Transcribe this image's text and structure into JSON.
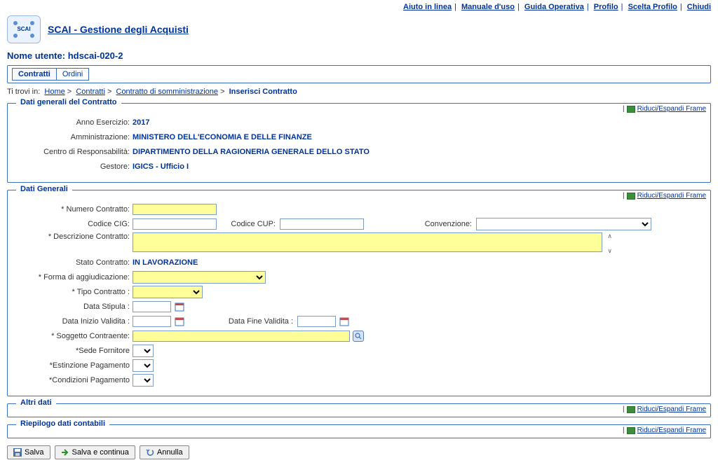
{
  "topLinks": {
    "help": "Aiuto in linea",
    "manual": "Manuale d'uso",
    "guide": "Guida Operativa",
    "profile": "Profilo",
    "choose": "Scelta Profilo",
    "close": "Chiudi"
  },
  "appTitle": "SCAI - Gestione degli Acquisti",
  "userLabel": "Nome utente:",
  "userName": "hdscai-020-2",
  "tabs": {
    "contratti": "Contratti",
    "ordini": "Ordini"
  },
  "breadcrumb": {
    "prefix": "Ti trovi in:",
    "home": "Home",
    "contratti": "Contratti",
    "somm": "Contratto di somministrazione",
    "current": "Inserisci Contratto"
  },
  "frameToggle": "Riduci/Espandi Frame",
  "section1": {
    "legend": "Dati generali del Contratto",
    "anno": {
      "label": "Anno Esercizio:",
      "value": "2017"
    },
    "ammin": {
      "label": "Amministrazione:",
      "value": "MINISTERO DELL'ECONOMIA E DELLE FINANZE"
    },
    "centro": {
      "label": "Centro di Responsabilità:",
      "value": "DIPARTIMENTO DELLA RAGIONERIA GENERALE DELLO STATO"
    },
    "gestore": {
      "label": "Gestore:",
      "value": "IGICS - Ufficio I"
    }
  },
  "section2": {
    "legend": "Dati Generali",
    "numero": "* Numero Contratto:",
    "cig": "Codice CIG:",
    "cup": "Codice CUP:",
    "conv": "Convenzione:",
    "desc": "* Descrizione Contratto:",
    "stato": {
      "label": "Stato Contratto:",
      "value": "IN LAVORAZIONE"
    },
    "forma": "* Forma di aggiudicazione:",
    "tipo": "* Tipo Contratto :",
    "stipula": "Data Stipula :",
    "inizio": "Data Inizio Validita :",
    "fine": "Data Fine Validita :",
    "sogg": "* Soggetto Contraente:",
    "sede": "*Sede Fornitore",
    "estin": "*Estinzione Pagamento",
    "cond": "*Condizioni Pagamento"
  },
  "section3": {
    "legend": "Altri dati"
  },
  "section4": {
    "legend": "Riepilogo dati contabili"
  },
  "buttons": {
    "salva": "Salva",
    "salvaCont": "Salva e continua",
    "annulla": "Annulla"
  }
}
